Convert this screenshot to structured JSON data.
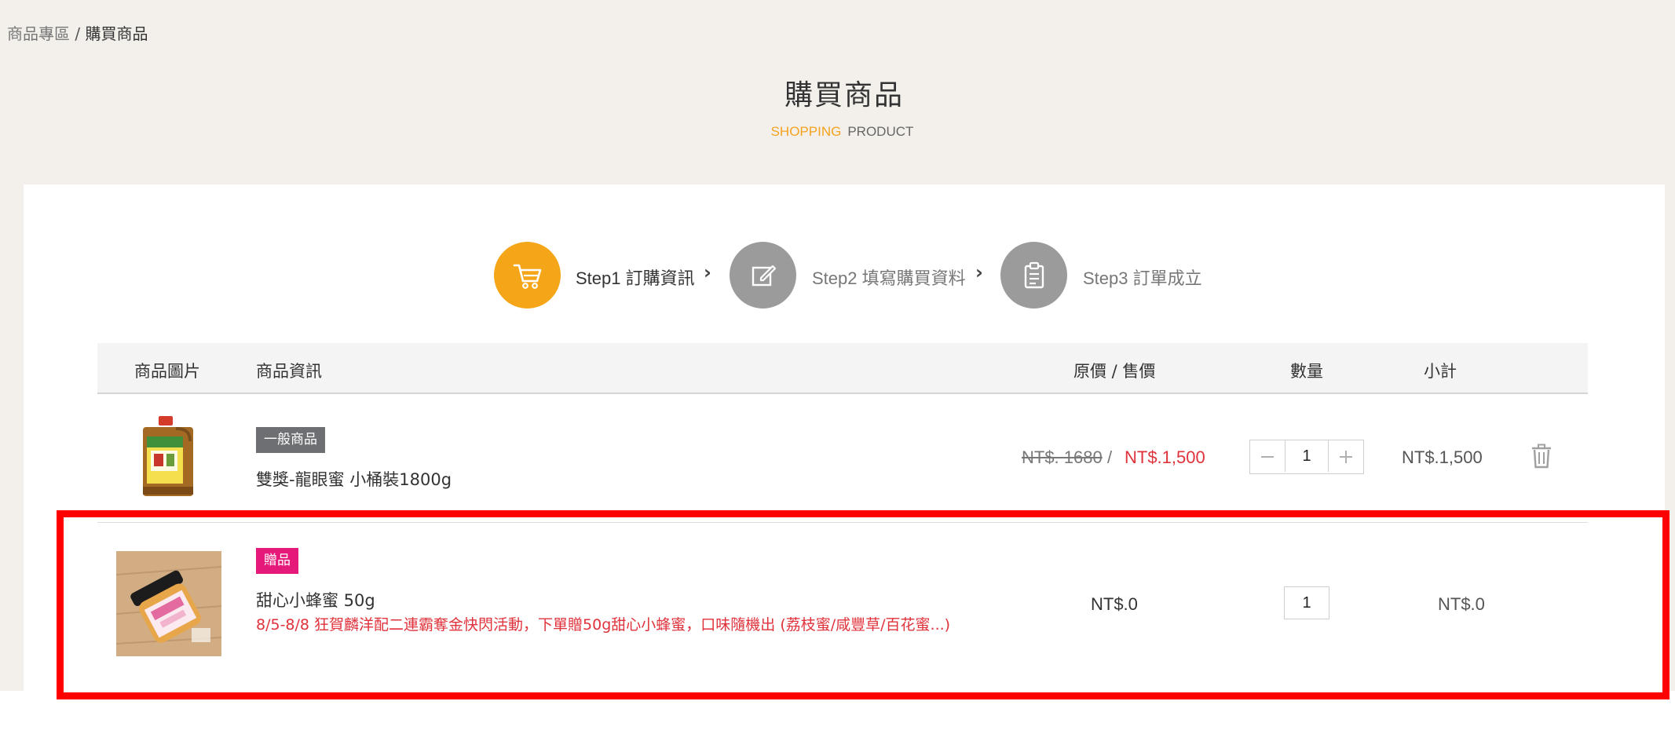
{
  "breadcrumb": {
    "parent": "商品專區",
    "separator": " / ",
    "current": "購買商品"
  },
  "page": {
    "title": "購買商品",
    "subtitle_highlight": "SHOPPING",
    "subtitle_rest": "PRODUCT"
  },
  "steps": [
    {
      "label": "Step1 訂購資訊",
      "icon": "cart-icon",
      "active": true
    },
    {
      "label": "Step2 填寫購買資料",
      "icon": "edit-icon",
      "active": false
    },
    {
      "label": "Step3 訂單成立",
      "icon": "clipboard-icon",
      "active": false
    }
  ],
  "step_arrow": "›",
  "table": {
    "headers": {
      "image": "商品圖片",
      "info": "商品資訊",
      "price": "原價 / 售價",
      "qty": "數量",
      "subtotal": "小計"
    },
    "rows": [
      {
        "tag": "一般商品",
        "name": "雙獎-龍眼蜜 小桶裝1800g",
        "original_price": "NT$. 1680",
        "price_separator": " / ",
        "sale_price": "NT$.1,500",
        "quantity": "1",
        "subtotal": "NT$.1,500",
        "image": "honey-bucket-thumbnail"
      },
      {
        "tag": "贈品",
        "name": "甜心小蜂蜜 50g",
        "promo": "8/5-8/8 狂賀麟洋配二連霸奪金快閃活動，下單贈50g甜心小蜂蜜，口味隨機出 (荔枝蜜/咸豐草/百花蜜...)",
        "price": "NT$.0",
        "quantity": "1",
        "subtotal": "NT$.0",
        "image": "honey-jar-thumbnail"
      }
    ]
  },
  "colors": {
    "page_background": "#f3f0ec",
    "accent": "#f5a618",
    "step_inactive": "#9b9b9b",
    "sale_price": "#e0323b",
    "gift_tag": "#e4197a",
    "general_tag": "#6d6f73",
    "highlight": "#ff0000"
  }
}
